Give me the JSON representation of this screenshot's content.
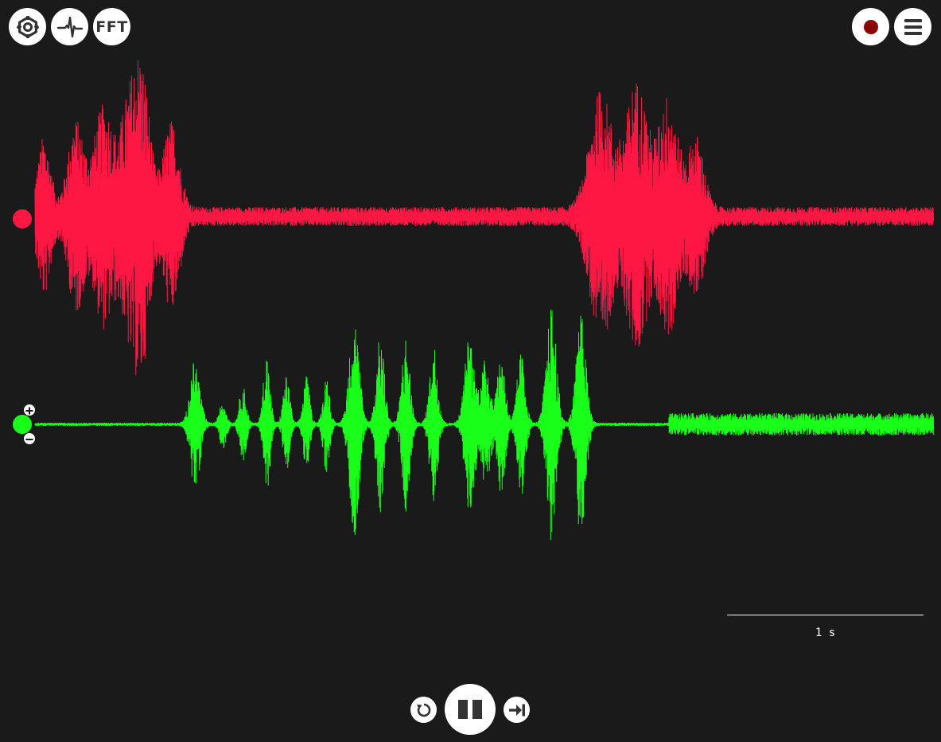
{
  "toolbar_left": {
    "settings_icon": "gear-icon",
    "threshold_icon": "spike-waveform-icon",
    "fft_label": "FFT"
  },
  "toolbar_right": {
    "record_icon": "record-icon",
    "menu_icon": "hamburger-menu-icon"
  },
  "channels": [
    {
      "name_icon": "channel-handle-icon",
      "color": "#ff1744"
    },
    {
      "name_icon": "channel-handle-icon",
      "color": "#1aff1a"
    }
  ],
  "zoom": {
    "in_icon": "plus-icon",
    "out_icon": "minus-icon"
  },
  "timescale": {
    "label": "1 s"
  },
  "playback": {
    "rewind_icon": "rewind-icon",
    "pause_icon": "pause-icon",
    "skip_icon": "skip-to-end-icon"
  },
  "colors": {
    "background": "#1a1a1a",
    "button": "#ffffff",
    "record": "#8b0000"
  }
}
